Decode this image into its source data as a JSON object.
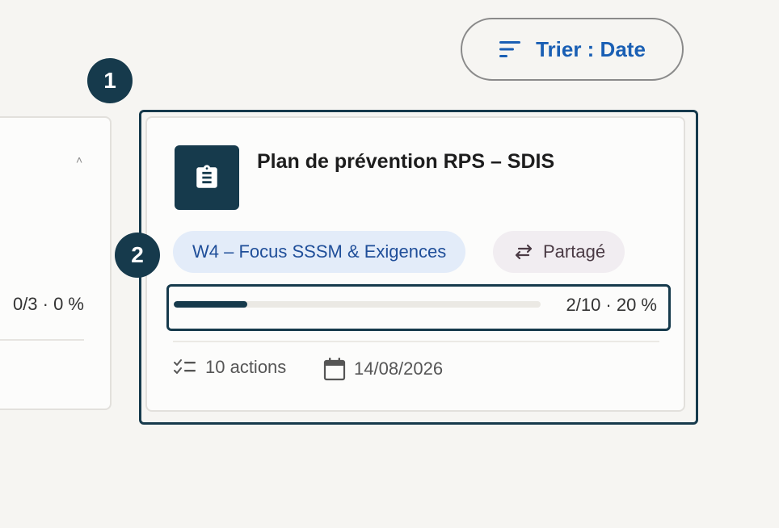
{
  "toolbar": {
    "sort_label": "Trier : Date"
  },
  "steps": [
    "1",
    "2"
  ],
  "left_card": {
    "progress_text": "0/3 · 0 %"
  },
  "card": {
    "title": "Plan de prévention RPS – SDIS",
    "icon": "clipboard-icon",
    "tags": {
      "week": "W4 – Focus SSSM & Exigences",
      "shared": "Partagé"
    },
    "progress": {
      "done": 2,
      "total": 10,
      "percent": 20,
      "text": "2/10 · 20 %"
    },
    "actions_label": "10 actions",
    "due_date": "14/08/2026"
  },
  "colors": {
    "accent_dark": "#163a4c",
    "link_blue": "#1a5fb4",
    "tag_blue_bg": "#e3ecf9",
    "tag_purple_bg": "#f1edf1"
  }
}
